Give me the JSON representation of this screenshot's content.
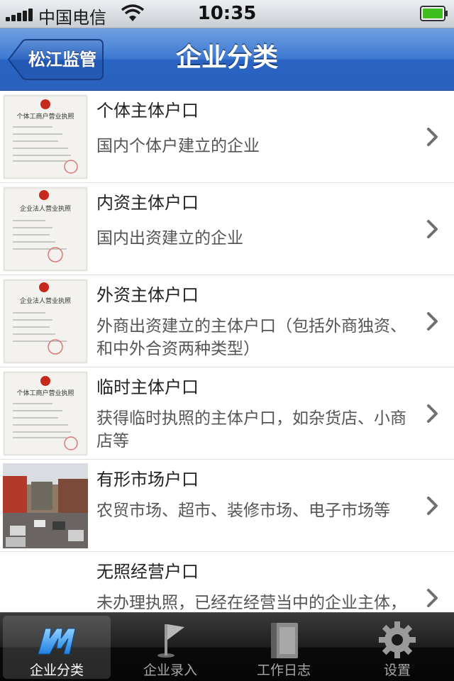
{
  "status_bar": {
    "carrier": "中国电信",
    "time": "10:35"
  },
  "nav": {
    "back_label": "松江监管",
    "title": "企业分类"
  },
  "list": [
    {
      "title": "个体主体户口",
      "description": "国内个体户建立的企业",
      "thumbnail": "个体工商户营业执照 certificate"
    },
    {
      "title": "内资主体户口",
      "description": "国内出资建立的企业",
      "thumbnail": "企业法人营业执照 certificate"
    },
    {
      "title": "外资主体户口",
      "description": "外商出资建立的主体户口（包括外商独资、和中外合资两种类型）",
      "thumbnail": "企业法人营业执照 certificate"
    },
    {
      "title": "临时主体户口",
      "description": "获得临时执照的主体户口，如杂货店、小商店等",
      "thumbnail": "个体工商户营业执照 certificate"
    },
    {
      "title": "有形市场户口",
      "description": "农贸市场、超市、装修市场、电子市场等",
      "thumbnail": "market street photo"
    },
    {
      "title": "无照经营户口",
      "description": "未办理执照，已经在经营当中的企业主体，未办理执照",
      "thumbnail": "none"
    }
  ],
  "thumb_text": {
    "individual": "个体工商户营业执照",
    "corporate": "企业法人营业执照"
  },
  "tabs": [
    {
      "label": "企业分类",
      "icon": "m-logo-icon",
      "active": true
    },
    {
      "label": "企业录入",
      "icon": "flag-icon",
      "active": false
    },
    {
      "label": "工作日志",
      "icon": "journal-icon",
      "active": false
    },
    {
      "label": "设置",
      "icon": "gear-icon",
      "active": false
    }
  ],
  "colors": {
    "nav_blue": "#2f6ac6",
    "tab_bar": "#111111"
  }
}
